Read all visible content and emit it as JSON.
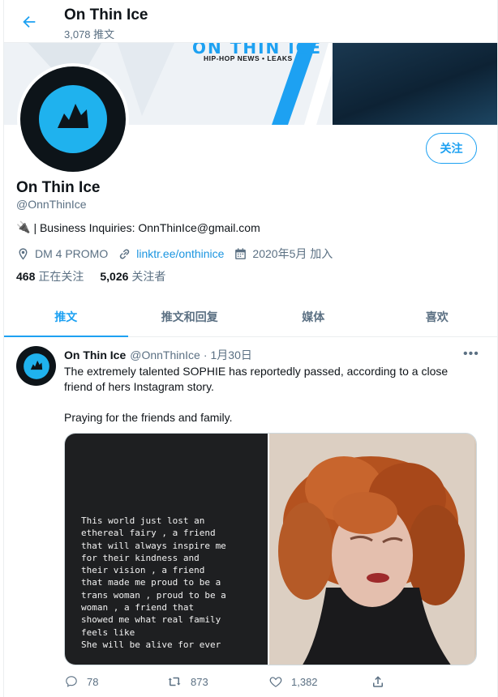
{
  "header": {
    "title": "On Thin Ice",
    "tweet_count": "3,078 推文"
  },
  "banner": {
    "logo_text": "ON THIN ICE",
    "tagline": "HIP-HOP NEWS • LEAKS"
  },
  "profile": {
    "follow_label": "关注",
    "name": "On Thin Ice",
    "handle": "@OnnThinIce",
    "bio_emoji": "🔌",
    "bio": "| Business Inquiries: OnnThinIce@gmail.com",
    "location": "DM 4 PROMO",
    "link": "linktr.ee/onthinice",
    "joined": "2020年5月 加入",
    "following_count": "468",
    "following_label": "正在关注",
    "followers_count": "5,026",
    "followers_label": "关注者"
  },
  "tabs": [
    {
      "label": "推文",
      "active": true
    },
    {
      "label": "推文和回复",
      "active": false
    },
    {
      "label": "媒体",
      "active": false
    },
    {
      "label": "喜欢",
      "active": false
    }
  ],
  "tweet": {
    "name": "On Thin Ice",
    "handle": "@OnnThinIce",
    "dot": "·",
    "time": "1月30日",
    "more": "•••",
    "text": "The extremely talented SOPHIE has reportedly passed, according to a close friend of hers Instagram story.\n\nPraying for the friends and family.",
    "image_text": "This world just lost an\nethereal fairy , a friend\nthat will always inspire me\nfor their kindness and\ntheir vision , a friend\nthat made me proud to be a\ntrans woman , proud to be a\nwoman , a friend that\nshowed me what real family\nfeels like\nShe will be alive for ever",
    "replies": "78",
    "retweets": "873",
    "likes": "1,382"
  },
  "colors": {
    "accent": "#1da1f2",
    "text_secondary": "#5b7083"
  }
}
